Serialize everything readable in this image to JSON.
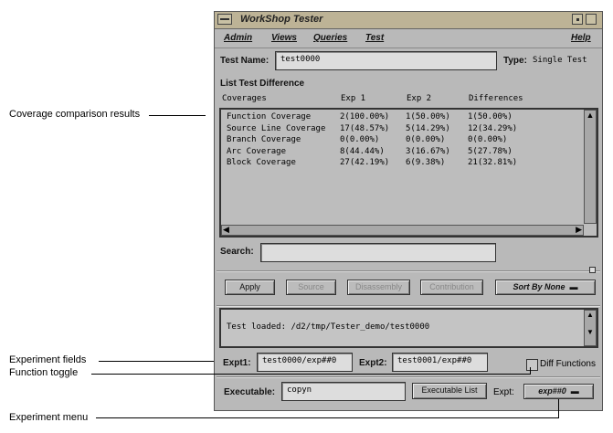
{
  "annotations": {
    "coverage": "Coverage comparison results",
    "expfields": "Experiment fields",
    "toggle": "Function toggle",
    "expmenu": "Experiment menu"
  },
  "window": {
    "title": "WorkShop Tester"
  },
  "menu": [
    "Admin",
    "Views",
    "Queries",
    "Test",
    "Help"
  ],
  "test_name": {
    "label": "Test Name:",
    "value": "test0000",
    "type_label": "Type:",
    "type_value": "Single Test"
  },
  "list": {
    "title": "List Test Difference",
    "headers": [
      "Coverages",
      "Exp 1",
      "Exp 2",
      "Differences"
    ],
    "rows": [
      [
        "Function Coverage",
        "2(100.00%)",
        "1(50.00%)",
        "1(50.00%)"
      ],
      [
        "Source Line Coverage",
        "17(48.57%)",
        "5(14.29%)",
        "12(34.29%)"
      ],
      [
        "Branch Coverage",
        "0(0.00%)",
        "0(0.00%)",
        "0(0.00%)"
      ],
      [
        "Arc Coverage",
        "8(44.44%)",
        "3(16.67%)",
        "5(27.78%)"
      ],
      [
        "Block Coverage",
        "27(42.19%)",
        "6(9.38%)",
        "21(32.81%)"
      ]
    ]
  },
  "search": {
    "label": "Search:",
    "value": ""
  },
  "buttons": {
    "apply": "Apply",
    "source": "Source",
    "disassembly": "Disassembly",
    "contribution": "Contribution",
    "sort": "Sort By None"
  },
  "message": "Test loaded: /d2/tmp/Tester_demo/test0000",
  "expt1": {
    "label": "Expt1:",
    "value": "test0000/exp##0"
  },
  "expt2": {
    "label": "Expt2:",
    "value": "test0001/exp##0"
  },
  "diff_functions": {
    "label": "Diff Functions",
    "checked": false
  },
  "executable": {
    "label": "Executable:",
    "value": "copyn",
    "list_button": "Executable List",
    "expt_label": "Expt:",
    "expt_value": "exp##0"
  }
}
